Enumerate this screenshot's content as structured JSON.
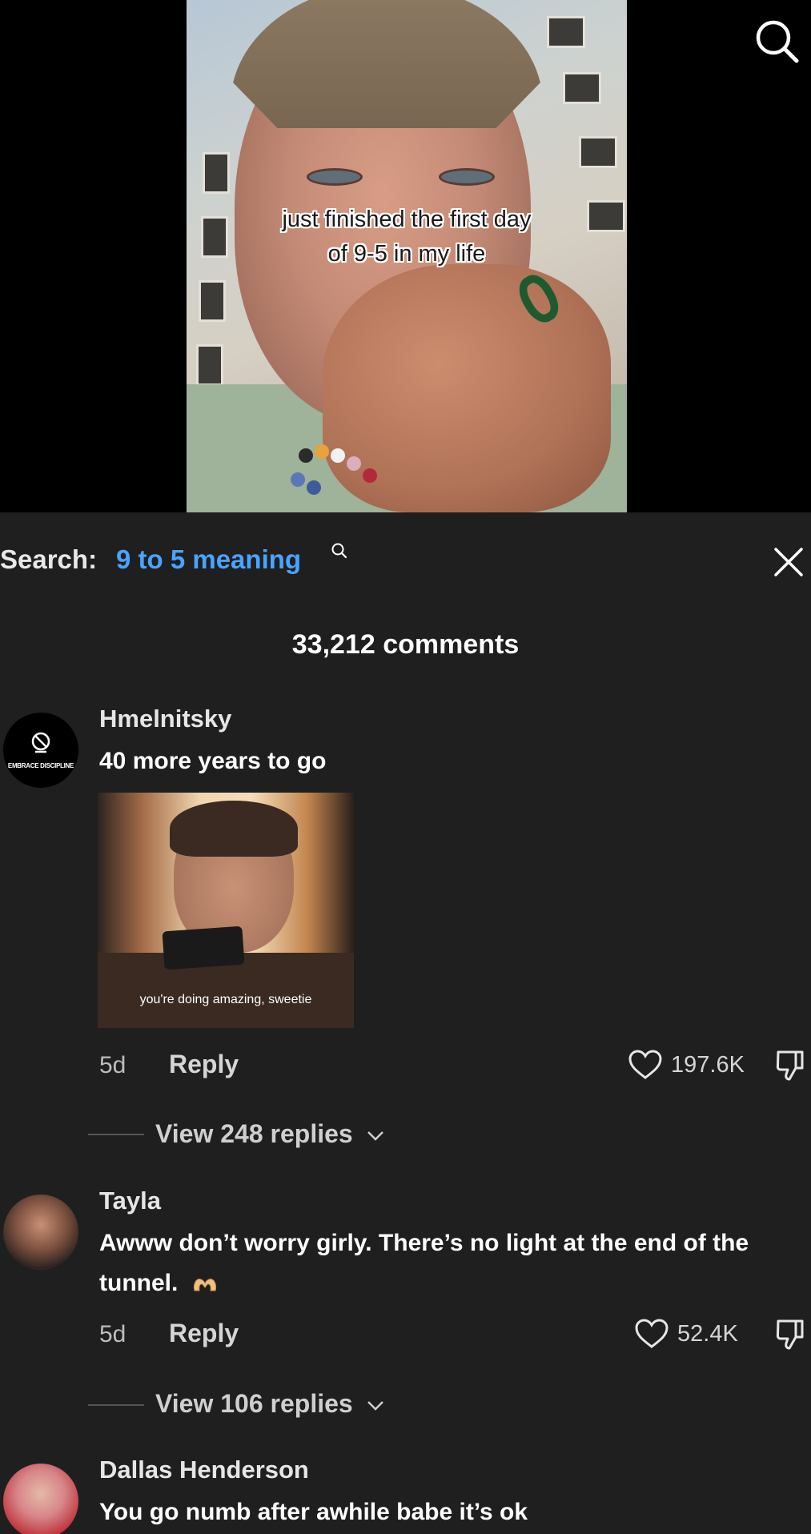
{
  "video": {
    "caption_line1": "just finished the first day",
    "caption_line2": "of 9-5 in my life"
  },
  "search": {
    "label": "Search:",
    "query": "9 to 5 meaning"
  },
  "comments_header": {
    "count_text": "33,212 comments"
  },
  "comments": [
    {
      "username": "Hmelnitsky",
      "avatar_text": "EMBRACE DISCIPLINE",
      "text": "40 more years to go",
      "gif_caption": "you're doing amazing, sweetie",
      "age": "5d",
      "reply_label": "Reply",
      "likes": "197.6K",
      "view_replies": "View 248 replies"
    },
    {
      "username": "Tayla",
      "text_line1": "Awww don’t worry girly. There’s no light at the end of the",
      "text_line2": "tunnel.",
      "age": "5d",
      "reply_label": "Reply",
      "likes": "52.4K",
      "view_replies": "View 106 replies"
    },
    {
      "username": "Dallas Henderson",
      "text": "You go numb after awhile babe it’s ok"
    }
  ],
  "colors": {
    "background": "#1f1f1f",
    "search_query": "#4aa3ff",
    "text": "#ffffff",
    "muted": "#bdbdbd"
  }
}
